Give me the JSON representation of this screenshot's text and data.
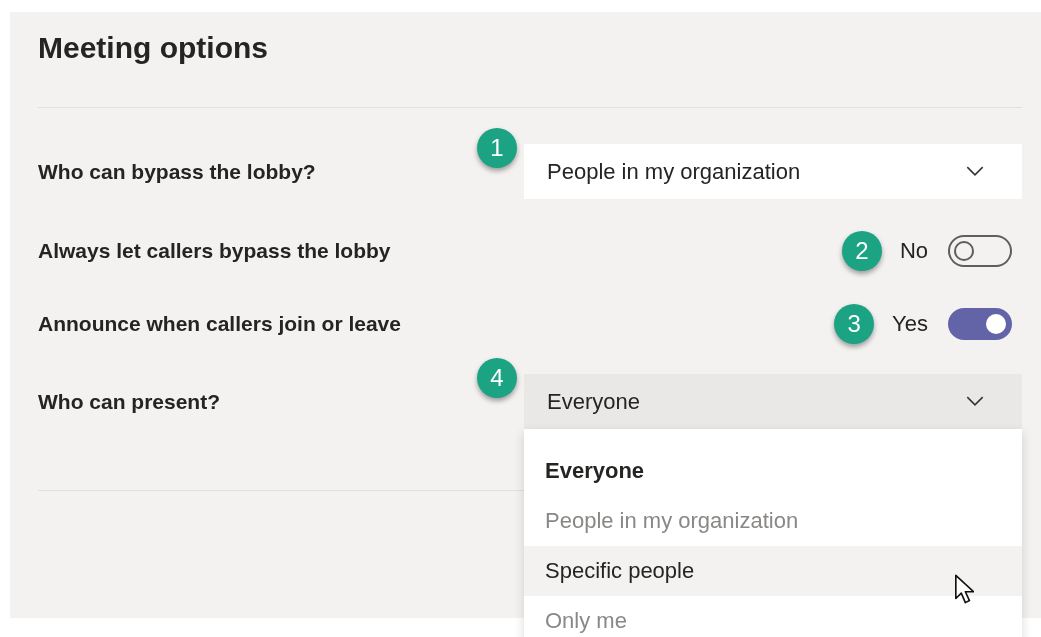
{
  "title": "Meeting options",
  "rows": [
    {
      "kind": "dropdown",
      "label": "Who can bypass the lobby?",
      "badge": "1",
      "value": "People in my organization",
      "open": false
    },
    {
      "kind": "toggle",
      "label": "Always let callers bypass the lobby",
      "badge": "2",
      "value": "No",
      "on": false
    },
    {
      "kind": "toggle",
      "label": "Announce when callers join or leave",
      "badge": "3",
      "value": "Yes",
      "on": true
    },
    {
      "kind": "dropdown",
      "label": "Who can present?",
      "badge": "4",
      "value": "Everyone",
      "open": true,
      "options": [
        {
          "label": "Everyone",
          "selected": true,
          "hovered": false
        },
        {
          "label": "People in my organization",
          "selected": false,
          "hovered": false
        },
        {
          "label": "Specific people",
          "selected": false,
          "hovered": true
        },
        {
          "label": "Only me",
          "selected": false,
          "hovered": false
        }
      ]
    }
  ]
}
